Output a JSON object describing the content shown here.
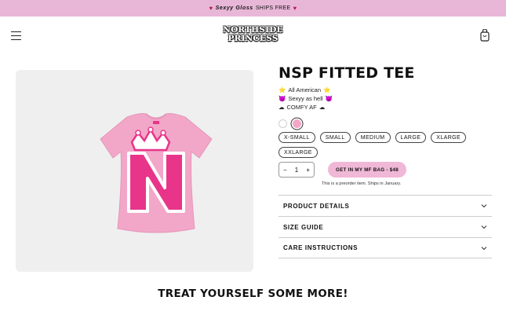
{
  "announcement": {
    "brand": "Sexyy Gloss",
    "text": "SHIPS FREE"
  },
  "header": {
    "logo_line1": "NORTHSIDE",
    "logo_line2": "PRINCESS"
  },
  "product": {
    "title": "NSP FITTED TEE",
    "tags": [
      {
        "emoji_left": "⭐",
        "text": "All American",
        "emoji_right": "⭐"
      },
      {
        "emoji_left": "😈",
        "text": "Sexyy as hell",
        "emoji_right": "😈"
      },
      {
        "emoji_left": "☁",
        "text": "COMFY AF",
        "emoji_right": "☁"
      }
    ],
    "colors": [
      "#ffffff",
      "#f2a7c8"
    ],
    "selected_color": "#f2a7c8",
    "sizes": [
      "X-SMALL",
      "SMALL",
      "MEDIUM",
      "LARGE",
      "XLARGE",
      "XXLARGE"
    ],
    "quantity": "1",
    "qty_minus": "−",
    "qty_plus": "+",
    "cart_button": "GET IN MY MF BAG - $48",
    "preorder_note": "This is a preorder item. Ships in January."
  },
  "accordions": [
    "PRODUCT DETAILS",
    "SIZE GUIDE",
    "CARE INSTRUCTIONS"
  ],
  "section_title": "TREAT YOURSELF SOME MORE!",
  "colors": {
    "announce_bg": "#e8b7d8",
    "cta_bg": "#f0b8d6",
    "tee_pink": "#f2a7c8",
    "letter_pink": "#e8358a"
  }
}
